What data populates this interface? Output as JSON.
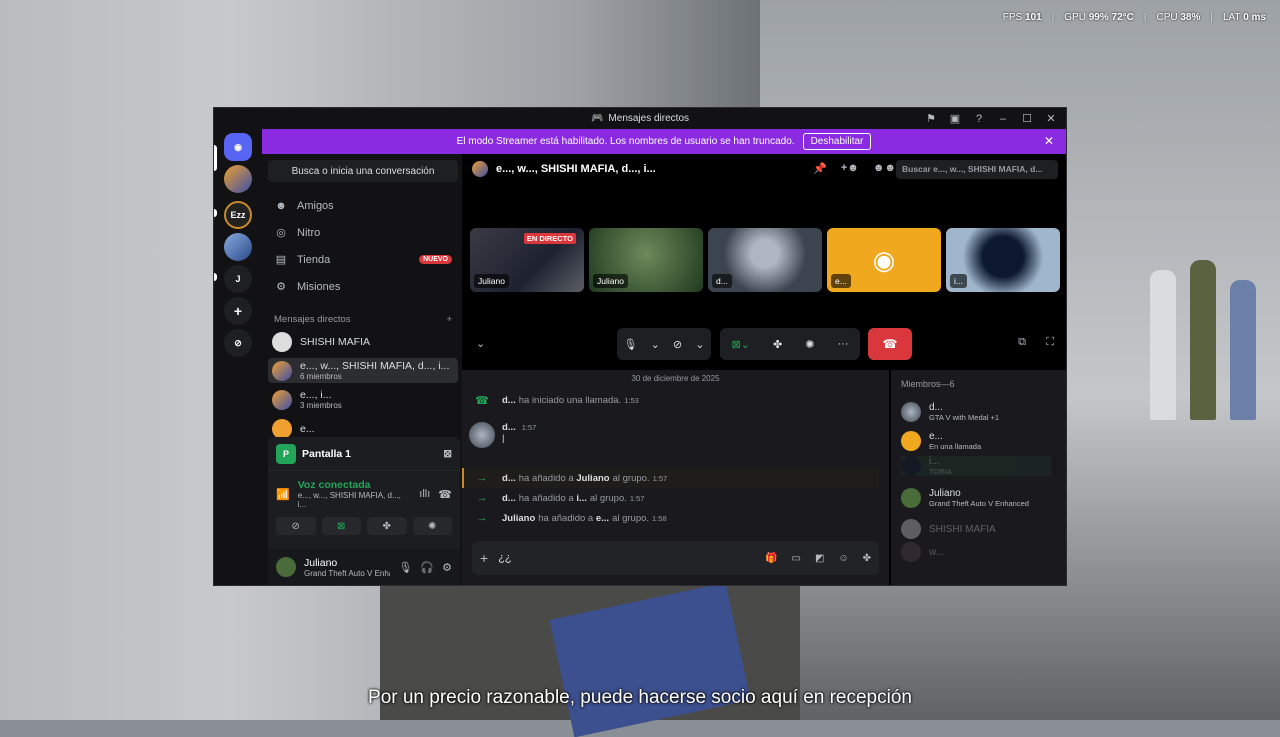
{
  "hud": {
    "fps_label": "FPS",
    "fps": "101",
    "gpu_label": "GPU",
    "gpu": "99%",
    "gpu_temp": "72°C",
    "cpu_label": "CPU",
    "cpu": "38%",
    "lat_label": "LAT",
    "lat": "0 ms"
  },
  "subtitle": "Por un precio razonable, puede hacerse socio aquí en recepción",
  "window": {
    "title": "Mensajes directos"
  },
  "banner": {
    "text": "El modo Streamer está habilitado. Los nombres de usuario se han truncado.",
    "button": "Deshabilitar"
  },
  "rail": {
    "servers": [
      "Ezz",
      "J"
    ]
  },
  "sidebar": {
    "search_placeholder": "Busca o inicia una conversación",
    "nav": [
      {
        "label": "Amigos"
      },
      {
        "label": "Nitro"
      },
      {
        "label": "Tienda",
        "badge": "NUEVO"
      },
      {
        "label": "Misiones"
      }
    ],
    "dm_header": "Mensajes directos",
    "dms": [
      {
        "name": "SHISHI MAFIA",
        "sub": ""
      },
      {
        "name": "e..., w..., SHISHI MAFIA, d..., i...",
        "sub": "6 miembros"
      },
      {
        "name": "e..., i...",
        "sub": "3 miembros"
      },
      {
        "name": "e...",
        "sub": ""
      }
    ]
  },
  "voice": {
    "screen": "Pantalla 1",
    "status": "Voz conectada",
    "channel": "e..., w..., SHISHI MAFIA, d..., i..."
  },
  "user": {
    "name": "Juliano",
    "status": "Grand Theft Auto V Enhanc..."
  },
  "channel": {
    "title": "e..., w..., SHISHI MAFIA, d..., i...",
    "search_placeholder": "Buscar e..., w..., SHISHI MAFIA, d..."
  },
  "tiles": [
    {
      "label": "Juliano",
      "live": "EN DIRECTO"
    },
    {
      "label": "Juliano"
    },
    {
      "label": "d..."
    },
    {
      "label": "e..."
    },
    {
      "label": "i..."
    }
  ],
  "chat": {
    "date": "30 de diciembre de 2025",
    "messages": [
      {
        "user": "d...",
        "text": "ha iniciado una llamada.",
        "time": "1:53"
      },
      {
        "user": "d...",
        "time": "1:57",
        "text": "|"
      },
      {
        "user": "d...",
        "text1": "ha añadido a",
        "target": "Juliano",
        "text2": "al grupo.",
        "time": "1:57"
      },
      {
        "user": "d...",
        "text1": "ha añadido a",
        "target": "i...",
        "text2": "al grupo.",
        "time": "1:57"
      },
      {
        "user": "Juliano",
        "text1": "ha añadido a",
        "target": "e...",
        "text2": "al grupo.",
        "time": "1:58"
      }
    ],
    "input": "¿¿"
  },
  "members": {
    "header": "Miembros—6",
    "list": [
      {
        "name": "d...",
        "status": "GTA V with Medal +1"
      },
      {
        "name": "e...",
        "status": "En una llamada"
      },
      {
        "name": "i...",
        "status": "TORIA"
      },
      {
        "name": "Juliano",
        "status": "Grand Theft Auto V Enhanced"
      },
      {
        "name": "SHISHI MAFIA",
        "status": ""
      },
      {
        "name": "w...",
        "status": ""
      }
    ]
  },
  "colors": {
    "accent": "#5865f2",
    "banner": "#8a2be2",
    "online": "#23a559",
    "danger": "#da373c"
  }
}
